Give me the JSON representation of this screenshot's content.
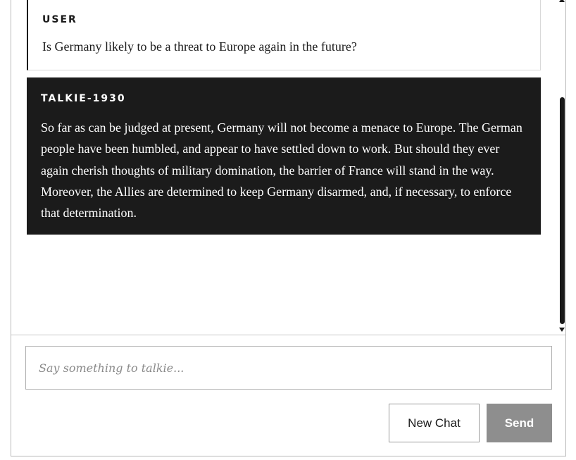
{
  "messages": [
    {
      "role": "USER",
      "text": "Is Germany likely to be a threat to Europe again in the future?"
    },
    {
      "role": "TALKIE-1930",
      "text": "So far as can be judged at present, Germany will not become a menace to Europe. The German people have been humbled, and appear to have settled down to work. But should they ever again cherish thoughts of military domination, the barrier of France will stand in the way. Moreover, the Allies are determined to keep Germany disarmed, and, if necessary, to enforce that determination."
    }
  ],
  "composer": {
    "placeholder": "Say something to talkie...",
    "value": ""
  },
  "buttons": {
    "new_chat": "New Chat",
    "send": "Send"
  },
  "colors": {
    "assistant_bg": "#1b1b1b",
    "send_bg": "#8e8e8e",
    "border": "#b8b8b8"
  }
}
